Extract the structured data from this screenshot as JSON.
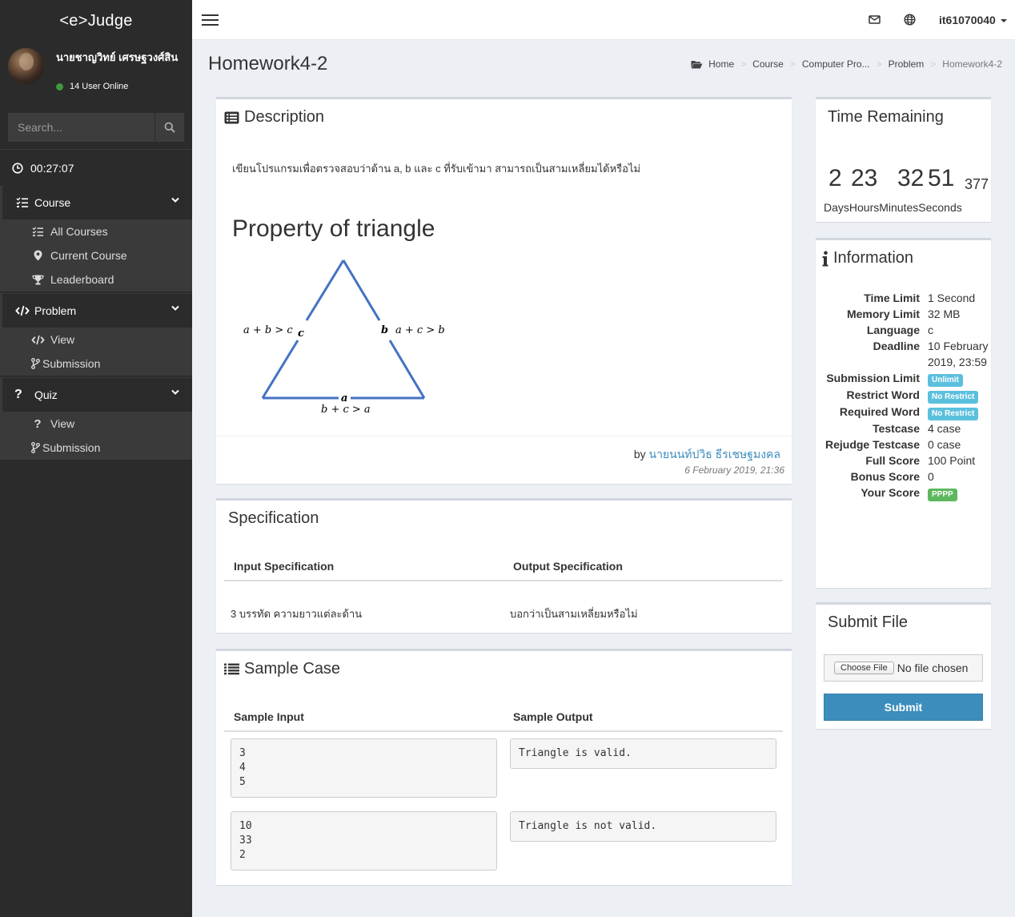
{
  "app": {
    "logo": "<e>Judge"
  },
  "user": {
    "name": "นายชาญวิทย์ เศรษฐวงศ์สิน",
    "online_text": "14 User Online",
    "username": "it61070040"
  },
  "search": {
    "placeholder": "Search..."
  },
  "timer": {
    "elapsed": "00:27:07"
  },
  "sidebar": {
    "course": {
      "label": "Course",
      "items": [
        "All Courses",
        "Current Course",
        "Leaderboard"
      ]
    },
    "problem": {
      "label": "Problem",
      "items": [
        "View",
        "Submission"
      ]
    },
    "quiz": {
      "label": "Quiz",
      "items": [
        "View",
        "Submission"
      ]
    }
  },
  "page": {
    "title": "Homework4-2"
  },
  "breadcrumb": [
    "Home",
    "Course",
    "Computer Pro...",
    "Problem",
    "Homework4-2"
  ],
  "description": {
    "title": "Description",
    "text": "เขียนโปรแกรมเพื่อตรวจสอบว่าด้าน a, b และ c ที่รับเข้ามา สามารถเป็นสามเหลี่ยมได้หรือไม่",
    "heading": "Property of triangle",
    "triangle": {
      "left_eq": "a + b > c",
      "left_var": "c",
      "right_var": "b",
      "right_eq": "a + c > b",
      "bottom_var": "a",
      "bottom_eq": "b + c > a"
    },
    "by_prefix": "by",
    "author": "นายนนท์ปวิธ ธีรเชษฐมงคล",
    "date": "6 February 2019, 21:36"
  },
  "specification": {
    "title": "Specification",
    "input_header": "Input Specification",
    "output_header": "Output Specification",
    "input_text": "3 บรรทัด ความยาวแต่ละด้าน",
    "output_text": "บอกว่าเป็นสามเหลี่ยมหรือไม่"
  },
  "sample": {
    "title": "Sample Case",
    "input_header": "Sample Input",
    "output_header": "Sample Output",
    "cases": [
      {
        "input": "3\n4\n5",
        "output": "Triangle is valid."
      },
      {
        "input": "10\n33\n2",
        "output": "Triangle is not valid."
      }
    ]
  },
  "countdown": {
    "title": "Time Remaining",
    "days": "2",
    "hours": "23",
    "minutes": "32",
    "seconds": "51",
    "ms": "377",
    "labels": "DaysHoursMinutesSeconds"
  },
  "information": {
    "title": "Information",
    "rows": [
      {
        "k": "Time Limit",
        "v": "1 Second"
      },
      {
        "k": "Memory Limit",
        "v": "32 MB"
      },
      {
        "k": "Language",
        "v": "c"
      },
      {
        "k": "Deadline",
        "v": "10 February 2019, 23:59"
      },
      {
        "k": "Submission Limit",
        "badge": "Unlimit"
      },
      {
        "k": "Restrict Word",
        "badge": "No Restrict"
      },
      {
        "k": "Required Word",
        "badge": "No Restrict"
      },
      {
        "k": "Testcase",
        "v": "4 case"
      },
      {
        "k": "Rejudge Testcase",
        "v": "0 case"
      },
      {
        "k": "Full Score",
        "v": "100 Point"
      },
      {
        "k": "Bonus Score",
        "v": "0"
      },
      {
        "k": "Your Score",
        "badge": "PPPP"
      }
    ]
  },
  "submit": {
    "title": "Submit File",
    "choose_label": "Choose File",
    "no_file": "No file chosen",
    "button": "Submit"
  },
  "colors": {
    "primary": "#3c8dbc",
    "info": "#5bc0de",
    "success": "#5cb85c",
    "sidebar": "#2b2b2b"
  }
}
